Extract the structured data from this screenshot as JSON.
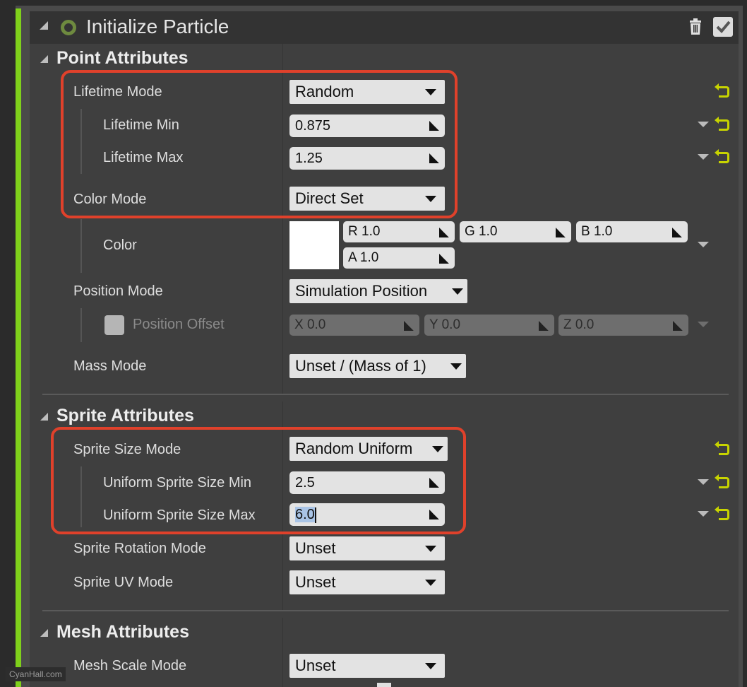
{
  "header": {
    "title": "Initialize Particle",
    "delete_icon": "trash-icon",
    "enable_icon": "checkbox-checked-icon"
  },
  "sections": {
    "point": {
      "title": "Point Attributes",
      "lifetime_mode": {
        "label": "Lifetime Mode",
        "value": "Random"
      },
      "lifetime_min": {
        "label": "Lifetime Min",
        "value": "0.875"
      },
      "lifetime_max": {
        "label": "Lifetime Max",
        "value": "1.25"
      },
      "color_mode": {
        "label": "Color Mode",
        "value": "Direct Set"
      },
      "color": {
        "label": "Color",
        "swatch": "#ffffff",
        "r": "R  1.0",
        "g": "G  1.0",
        "b": "B  1.0",
        "a": "A  1.0"
      },
      "position_mode": {
        "label": "Position Mode",
        "value": "Simulation Position"
      },
      "position_offset": {
        "label": "Position Offset",
        "checked": false,
        "x": "X  0.0",
        "y": "Y  0.0",
        "z": "Z  0.0"
      },
      "mass_mode": {
        "label": "Mass Mode",
        "value": "Unset / (Mass of 1)"
      }
    },
    "sprite": {
      "title": "Sprite Attributes",
      "size_mode": {
        "label": "Sprite Size Mode",
        "value": "Random Uniform"
      },
      "size_min": {
        "label": "Uniform Sprite Size Min",
        "value": "2.5"
      },
      "size_max": {
        "label": "Uniform Sprite Size Max",
        "value": "6.0"
      },
      "rotation_mode": {
        "label": "Sprite Rotation Mode",
        "value": "Unset"
      },
      "uv_mode": {
        "label": "Sprite UV Mode",
        "value": "Unset"
      }
    },
    "mesh": {
      "title": "Mesh Attributes",
      "scale_mode": {
        "label": "Mesh Scale Mode",
        "value": "Unset"
      }
    }
  },
  "colors": {
    "accent_green": "#7fd11b",
    "highlight_red": "#e0412b",
    "reset_yellow": "#c8d400"
  },
  "watermark": "CyanHall.com"
}
